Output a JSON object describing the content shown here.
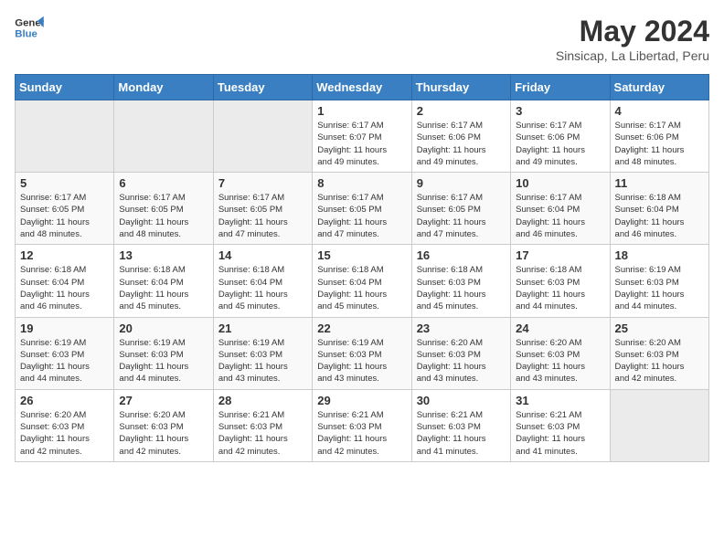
{
  "header": {
    "logo_line1": "General",
    "logo_line2": "Blue",
    "month_year": "May 2024",
    "location": "Sinsicap, La Libertad, Peru"
  },
  "weekdays": [
    "Sunday",
    "Monday",
    "Tuesday",
    "Wednesday",
    "Thursday",
    "Friday",
    "Saturday"
  ],
  "weeks": [
    [
      {
        "day": "",
        "info": ""
      },
      {
        "day": "",
        "info": ""
      },
      {
        "day": "",
        "info": ""
      },
      {
        "day": "1",
        "info": "Sunrise: 6:17 AM\nSunset: 6:07 PM\nDaylight: 11 hours\nand 49 minutes."
      },
      {
        "day": "2",
        "info": "Sunrise: 6:17 AM\nSunset: 6:06 PM\nDaylight: 11 hours\nand 49 minutes."
      },
      {
        "day": "3",
        "info": "Sunrise: 6:17 AM\nSunset: 6:06 PM\nDaylight: 11 hours\nand 49 minutes."
      },
      {
        "day": "4",
        "info": "Sunrise: 6:17 AM\nSunset: 6:06 PM\nDaylight: 11 hours\nand 48 minutes."
      }
    ],
    [
      {
        "day": "5",
        "info": "Sunrise: 6:17 AM\nSunset: 6:05 PM\nDaylight: 11 hours\nand 48 minutes."
      },
      {
        "day": "6",
        "info": "Sunrise: 6:17 AM\nSunset: 6:05 PM\nDaylight: 11 hours\nand 48 minutes."
      },
      {
        "day": "7",
        "info": "Sunrise: 6:17 AM\nSunset: 6:05 PM\nDaylight: 11 hours\nand 47 minutes."
      },
      {
        "day": "8",
        "info": "Sunrise: 6:17 AM\nSunset: 6:05 PM\nDaylight: 11 hours\nand 47 minutes."
      },
      {
        "day": "9",
        "info": "Sunrise: 6:17 AM\nSunset: 6:05 PM\nDaylight: 11 hours\nand 47 minutes."
      },
      {
        "day": "10",
        "info": "Sunrise: 6:17 AM\nSunset: 6:04 PM\nDaylight: 11 hours\nand 46 minutes."
      },
      {
        "day": "11",
        "info": "Sunrise: 6:18 AM\nSunset: 6:04 PM\nDaylight: 11 hours\nand 46 minutes."
      }
    ],
    [
      {
        "day": "12",
        "info": "Sunrise: 6:18 AM\nSunset: 6:04 PM\nDaylight: 11 hours\nand 46 minutes."
      },
      {
        "day": "13",
        "info": "Sunrise: 6:18 AM\nSunset: 6:04 PM\nDaylight: 11 hours\nand 45 minutes."
      },
      {
        "day": "14",
        "info": "Sunrise: 6:18 AM\nSunset: 6:04 PM\nDaylight: 11 hours\nand 45 minutes."
      },
      {
        "day": "15",
        "info": "Sunrise: 6:18 AM\nSunset: 6:04 PM\nDaylight: 11 hours\nand 45 minutes."
      },
      {
        "day": "16",
        "info": "Sunrise: 6:18 AM\nSunset: 6:03 PM\nDaylight: 11 hours\nand 45 minutes."
      },
      {
        "day": "17",
        "info": "Sunrise: 6:18 AM\nSunset: 6:03 PM\nDaylight: 11 hours\nand 44 minutes."
      },
      {
        "day": "18",
        "info": "Sunrise: 6:19 AM\nSunset: 6:03 PM\nDaylight: 11 hours\nand 44 minutes."
      }
    ],
    [
      {
        "day": "19",
        "info": "Sunrise: 6:19 AM\nSunset: 6:03 PM\nDaylight: 11 hours\nand 44 minutes."
      },
      {
        "day": "20",
        "info": "Sunrise: 6:19 AM\nSunset: 6:03 PM\nDaylight: 11 hours\nand 44 minutes."
      },
      {
        "day": "21",
        "info": "Sunrise: 6:19 AM\nSunset: 6:03 PM\nDaylight: 11 hours\nand 43 minutes."
      },
      {
        "day": "22",
        "info": "Sunrise: 6:19 AM\nSunset: 6:03 PM\nDaylight: 11 hours\nand 43 minutes."
      },
      {
        "day": "23",
        "info": "Sunrise: 6:20 AM\nSunset: 6:03 PM\nDaylight: 11 hours\nand 43 minutes."
      },
      {
        "day": "24",
        "info": "Sunrise: 6:20 AM\nSunset: 6:03 PM\nDaylight: 11 hours\nand 43 minutes."
      },
      {
        "day": "25",
        "info": "Sunrise: 6:20 AM\nSunset: 6:03 PM\nDaylight: 11 hours\nand 42 minutes."
      }
    ],
    [
      {
        "day": "26",
        "info": "Sunrise: 6:20 AM\nSunset: 6:03 PM\nDaylight: 11 hours\nand 42 minutes."
      },
      {
        "day": "27",
        "info": "Sunrise: 6:20 AM\nSunset: 6:03 PM\nDaylight: 11 hours\nand 42 minutes."
      },
      {
        "day": "28",
        "info": "Sunrise: 6:21 AM\nSunset: 6:03 PM\nDaylight: 11 hours\nand 42 minutes."
      },
      {
        "day": "29",
        "info": "Sunrise: 6:21 AM\nSunset: 6:03 PM\nDaylight: 11 hours\nand 42 minutes."
      },
      {
        "day": "30",
        "info": "Sunrise: 6:21 AM\nSunset: 6:03 PM\nDaylight: 11 hours\nand 41 minutes."
      },
      {
        "day": "31",
        "info": "Sunrise: 6:21 AM\nSunset: 6:03 PM\nDaylight: 11 hours\nand 41 minutes."
      },
      {
        "day": "",
        "info": ""
      }
    ]
  ]
}
